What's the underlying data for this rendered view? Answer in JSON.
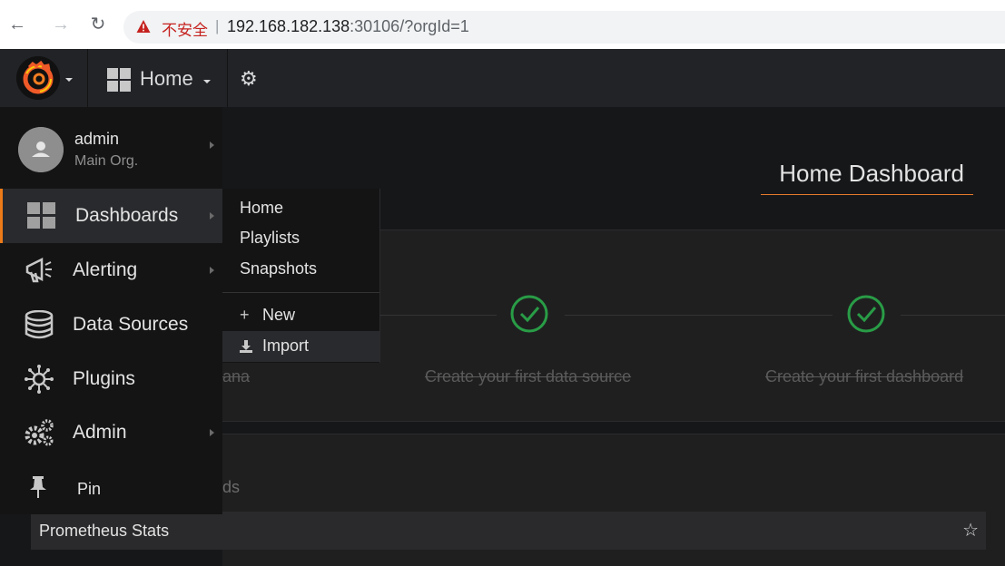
{
  "browser": {
    "security_label": "不安全",
    "separator": "|",
    "url_host": "192.168.182.138",
    "url_rest": ":30106/?orgId=1"
  },
  "navbar": {
    "home_label": "Home"
  },
  "dashboard": {
    "title": "Home Dashboard",
    "steps": [
      {
        "label": "ana"
      },
      {
        "label": "Create your first data source"
      },
      {
        "label": "Create your first dashboard"
      }
    ],
    "section_peek": "ds",
    "list_item": "Prometheus Stats"
  },
  "sidemenu": {
    "user": {
      "name": "admin",
      "org": "Main Org."
    },
    "items": [
      {
        "label": "Dashboards",
        "icon": "dashboards-icon"
      },
      {
        "label": "Alerting",
        "icon": "bullhorn-icon"
      },
      {
        "label": "Data Sources",
        "icon": "database-icon"
      },
      {
        "label": "Plugins",
        "icon": "plugins-icon"
      },
      {
        "label": "Admin",
        "icon": "cogs-icon"
      },
      {
        "label": "Pin",
        "icon": "pin-icon"
      }
    ]
  },
  "submenu": {
    "items": [
      "Home",
      "Playlists",
      "Snapshots"
    ],
    "new_label": "New",
    "import_label": "Import"
  },
  "colors": {
    "accent": "#eb7b18",
    "success": "#299c46",
    "background": "#161719"
  }
}
